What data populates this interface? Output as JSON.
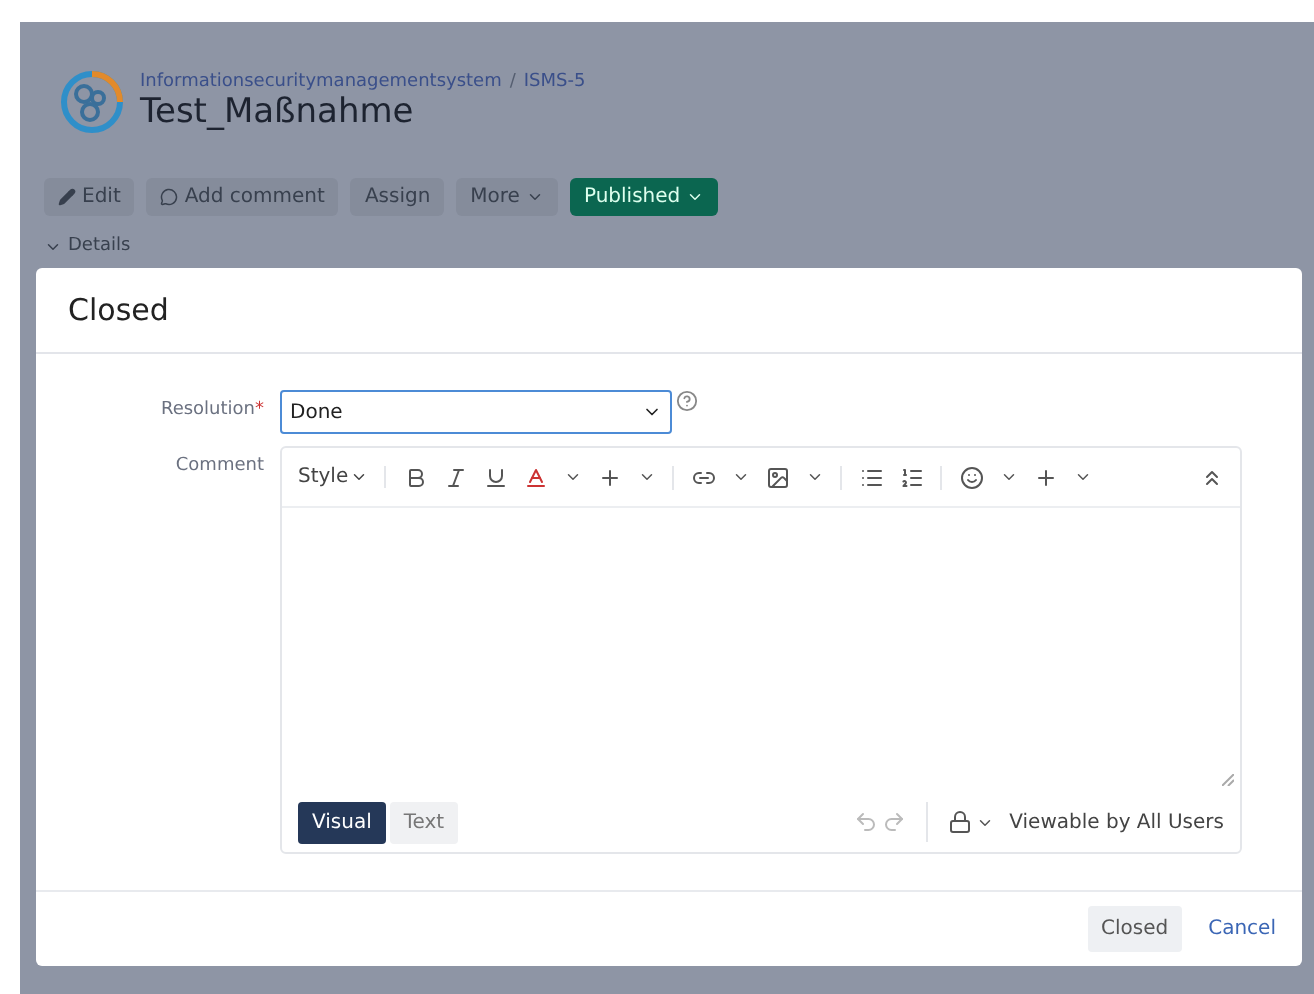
{
  "breadcrumbs": [
    "Informationsecuritymanagementsystem",
    "ISMS-5"
  ],
  "breadcrumb_separator": "/",
  "issue_title": "Test_Maßnahme",
  "actions": [
    {
      "label": "Edit",
      "kind": "edit"
    },
    {
      "label": "Add comment",
      "kind": "comment"
    },
    {
      "label": "Assign",
      "kind": "plain"
    },
    {
      "label": "More",
      "kind": "dropdown"
    },
    {
      "label": "Published",
      "kind": "status"
    }
  ],
  "details_toggle": {
    "label": "Details",
    "expanded": true
  },
  "dialog": {
    "title": "Closed",
    "resolution": {
      "label": "Resolution",
      "required_mark": "*",
      "value": "Done"
    },
    "comment": {
      "label": "Comment",
      "style_label": "Style",
      "modes": [
        {
          "label": "Visual",
          "selected": true
        },
        {
          "label": "Text",
          "selected": false
        }
      ],
      "visibility": "Viewable by All Users"
    },
    "buttons": [
      {
        "label": "Closed",
        "kind": "primary"
      },
      {
        "label": "Cancel",
        "kind": "link"
      }
    ]
  }
}
